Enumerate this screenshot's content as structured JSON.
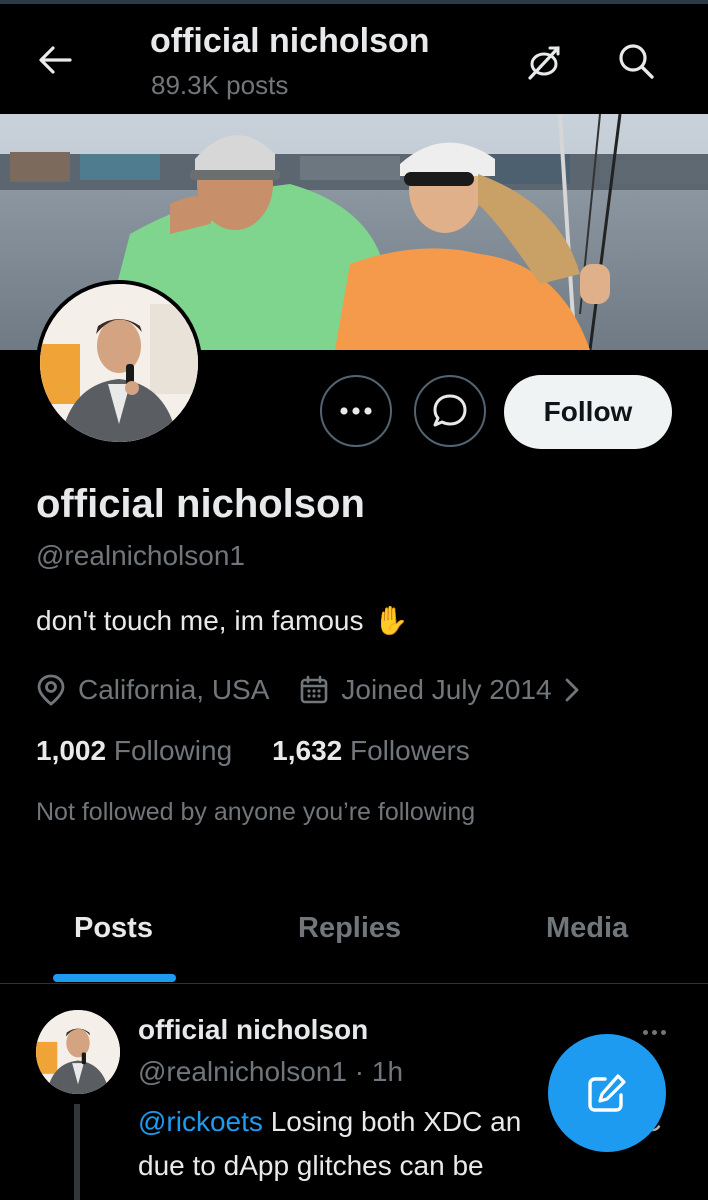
{
  "header": {
    "title": "official nicholson",
    "post_count": "89.3K posts"
  },
  "profile": {
    "name": "official nicholson",
    "handle": "@realnicholson1",
    "bio": "don't touch me, im famous",
    "bio_emoji": "✋",
    "location": "California, USA",
    "joined": "Joined July 2014",
    "following_count": "1,002",
    "following_label": "Following",
    "followers_count": "1,632",
    "followers_label": "Followers",
    "not_followed": "Not followed by anyone you’re following"
  },
  "actions": {
    "follow_label": "Follow"
  },
  "tabs": [
    {
      "label": "Posts",
      "active": true
    },
    {
      "label": "Replies",
      "active": false
    },
    {
      "label": "Media",
      "active": false
    }
  ],
  "post": {
    "name": "official nicholson",
    "handle": "@realnicholson1",
    "time": "1h",
    "separator": "·",
    "mention": "@rickoets",
    "text_line1": "Losing both XDC an",
    "text_line1_tail": "C",
    "text_line2": "due to dApp glitches can be"
  },
  "colors": {
    "accent": "#1d9bf0",
    "background": "#000000",
    "text_primary": "#e7e9ea",
    "text_secondary": "#71767b"
  },
  "icons": {
    "back": "arrow-left-icon",
    "hide": "eye-slash-icon",
    "search": "search-icon",
    "more": "more-horizontal-icon",
    "message": "message-bubble-icon",
    "location": "location-pin-icon",
    "calendar": "calendar-icon",
    "chevron": "chevron-right-icon",
    "compose": "compose-icon"
  }
}
